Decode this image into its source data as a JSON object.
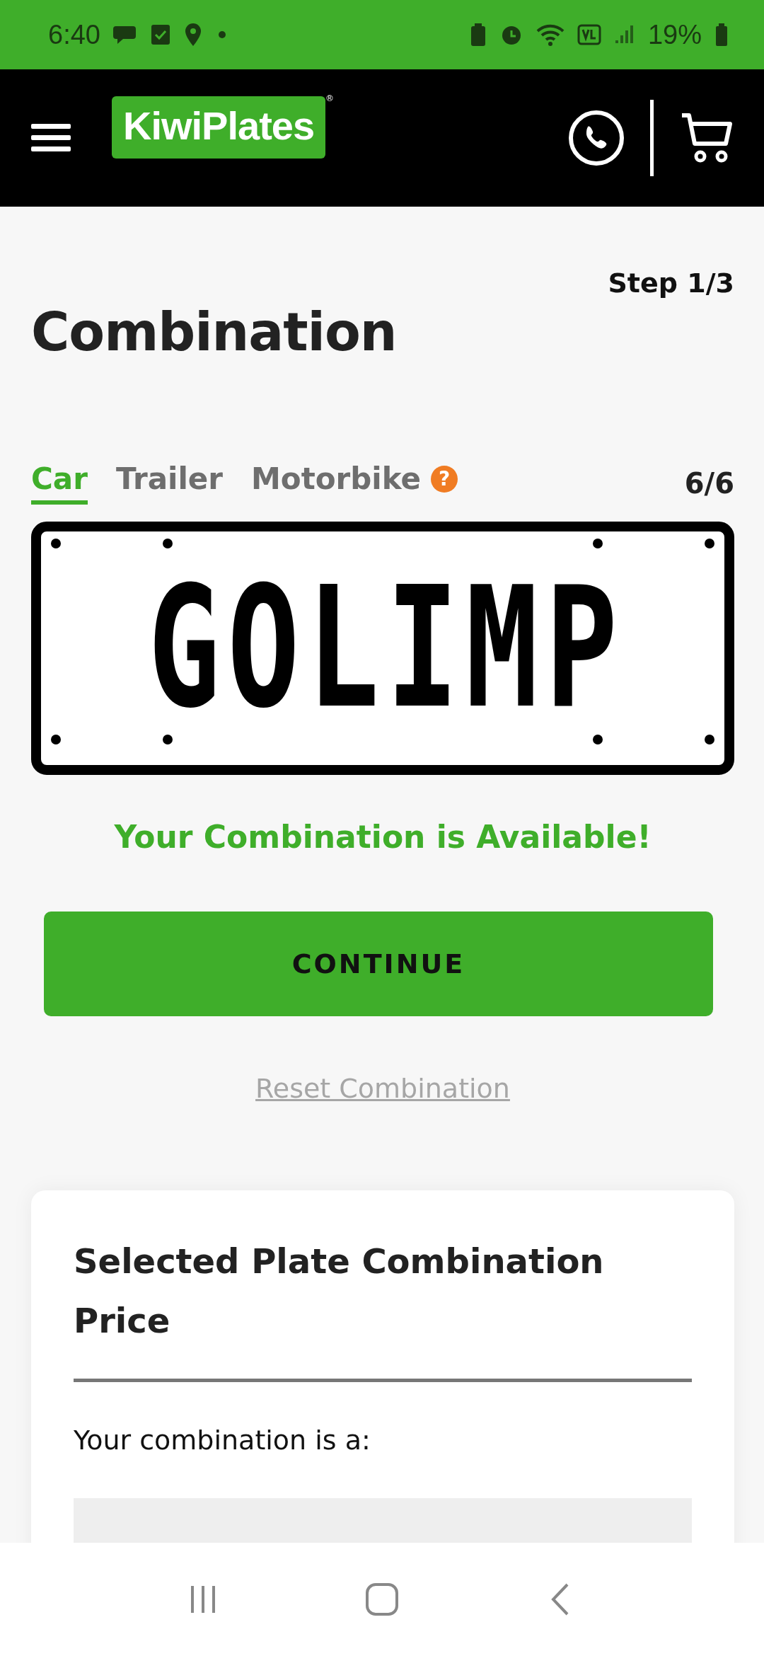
{
  "status_bar": {
    "time": "6:40",
    "battery": "19%"
  },
  "header": {
    "logo": "KiwiPlates",
    "logo_mark": "®"
  },
  "step": "Step 1/3",
  "title": "Combination",
  "tabs": [
    {
      "label": "Car",
      "selected": true
    },
    {
      "label": "Trailer",
      "selected": false
    },
    {
      "label": "Motorbike",
      "selected": false,
      "help": "?"
    }
  ],
  "counter": "6/6",
  "plate": {
    "text": "GOLIMP"
  },
  "availability": "Your Combination is Available!",
  "continue_button": "CONTINUE",
  "reset_link": "Reset Combination",
  "price_card": {
    "title": "Selected Plate Combination Price",
    "subtitle": "Your combination is a:"
  }
}
